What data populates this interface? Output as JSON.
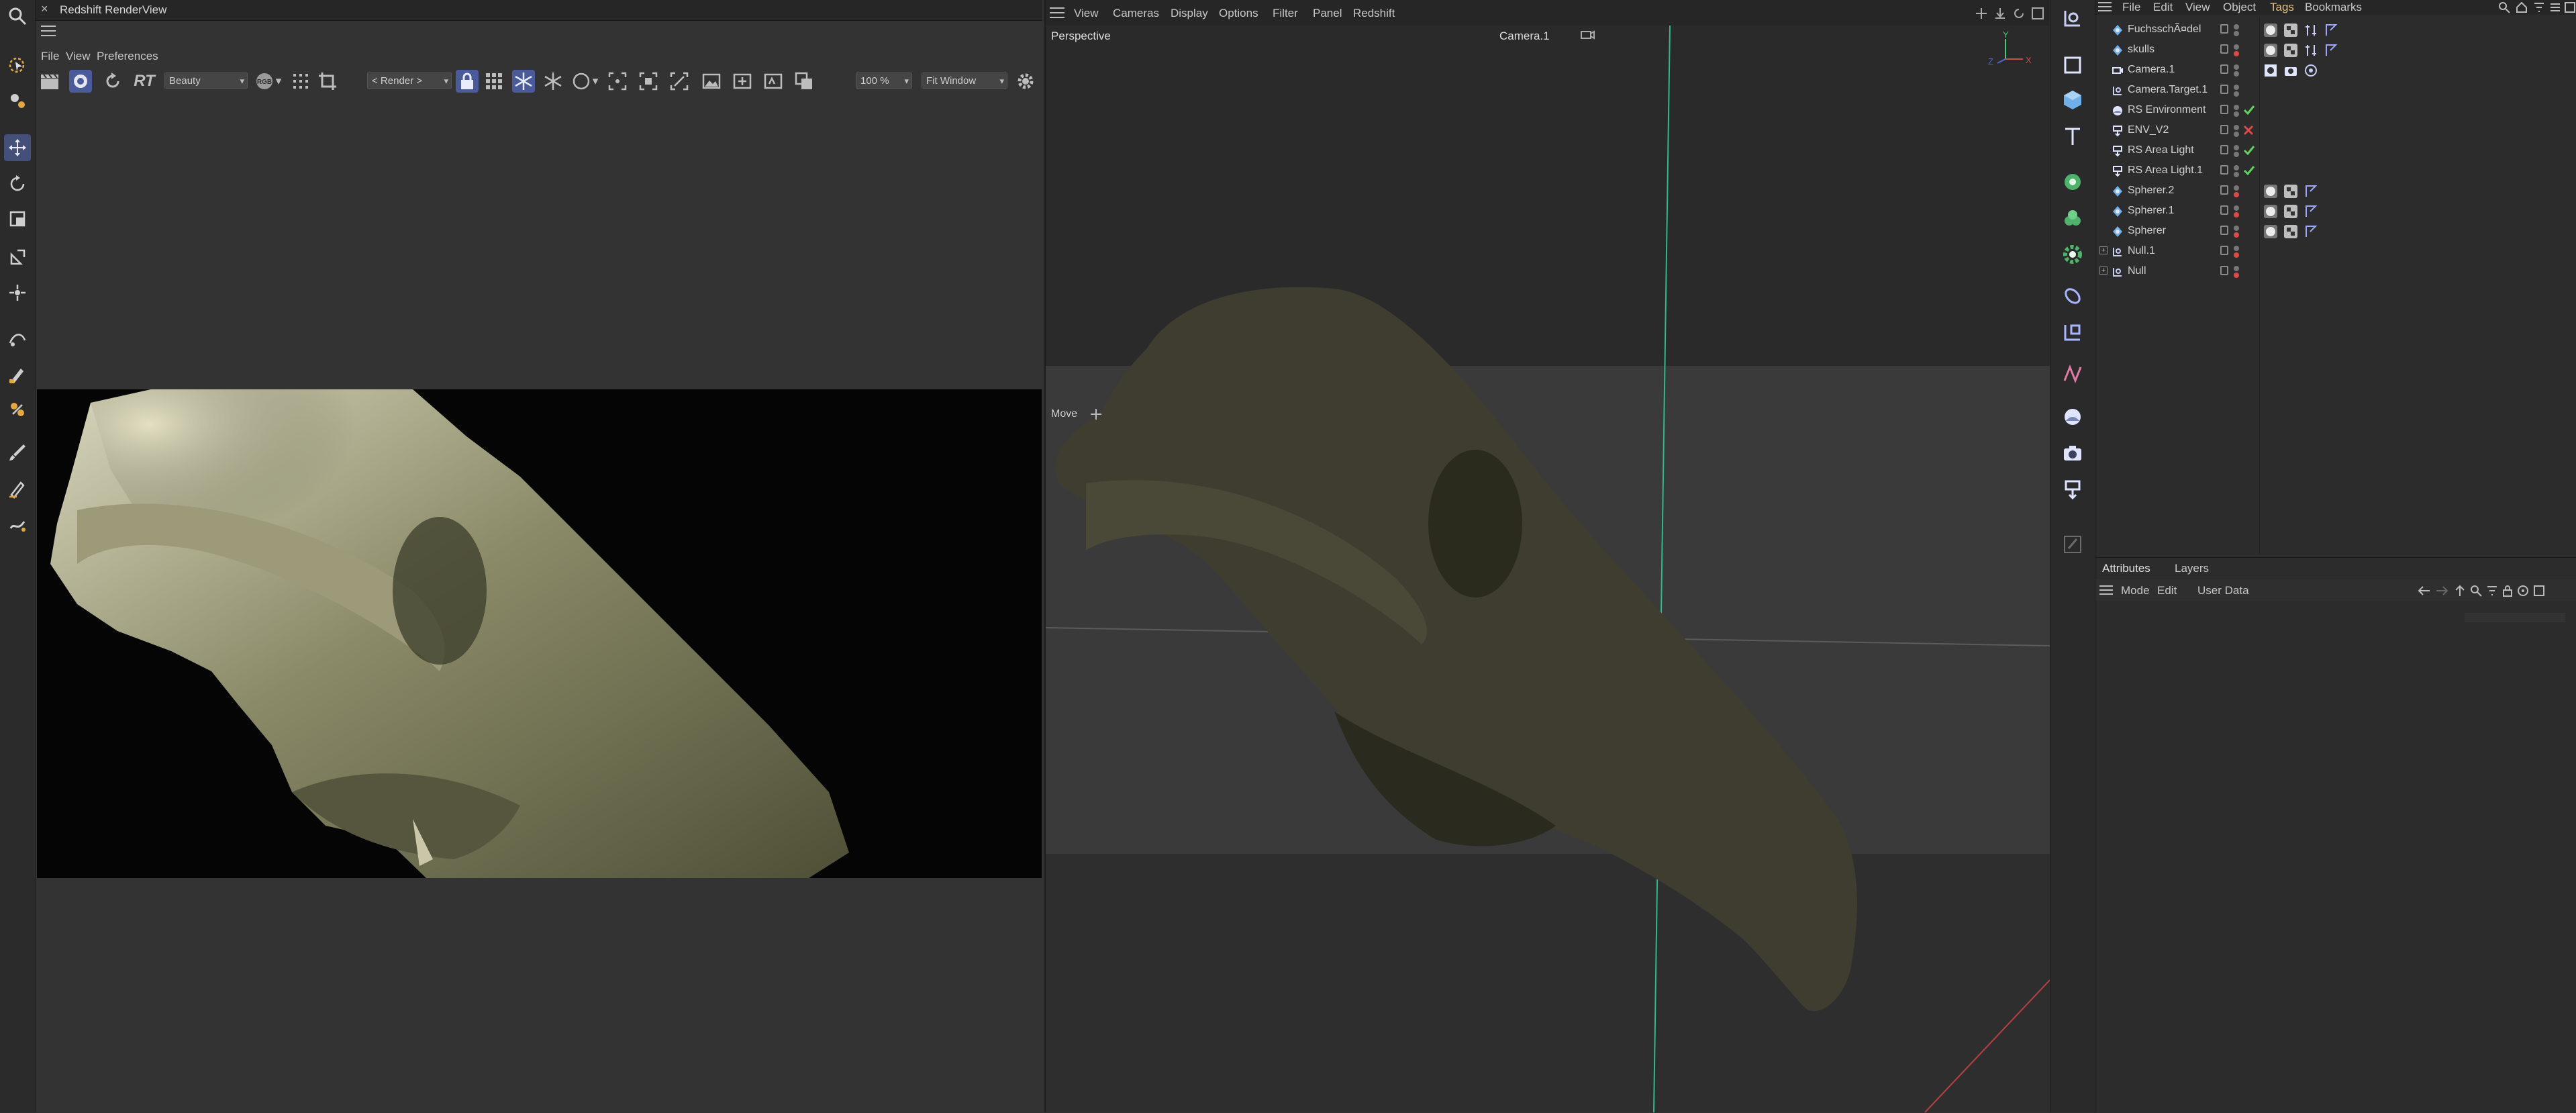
{
  "renderview": {
    "title": "Redshift RenderView",
    "close_glyph": "×",
    "menu": [
      "File",
      "View",
      "Preferences"
    ],
    "aov_select": "Beauty",
    "render_select": "< Render >",
    "zoom": "100 %",
    "fit_select": "Fit Window",
    "rt_label": "RT",
    "rgb_label": "RGB"
  },
  "viewport": {
    "menu": [
      "View",
      "Cameras",
      "Display",
      "Options",
      "Filter",
      "Panel",
      "Redshift"
    ],
    "projection": "Perspective",
    "camera": "Camera.1",
    "tool_label": "Move",
    "axis_labels": {
      "y": "Y",
      "x": "X",
      "z": "Z"
    }
  },
  "object_manager": {
    "menu": [
      "File",
      "Edit",
      "View",
      "Object",
      "Tags",
      "Bookmarks"
    ],
    "active_menu": "Tags",
    "objects": [
      {
        "name": "FuchsschÃ¤del",
        "icon": "sphere-generator-icon",
        "status": "dots",
        "tags": [
          "material",
          "phong",
          "sampler",
          "flag"
        ]
      },
      {
        "name": "skulls",
        "icon": "sphere-generator-icon",
        "status": "dots-red",
        "tags": [
          "material",
          "phong",
          "sampler",
          "flag"
        ]
      },
      {
        "name": "Camera.1",
        "icon": "camera-object-icon",
        "status": "dots",
        "tags": [
          "target",
          "camera",
          "protection"
        ]
      },
      {
        "name": "Camera.Target.1",
        "icon": "null-object-icon",
        "status": "dots",
        "tags": []
      },
      {
        "name": "RS Environment",
        "icon": "environment-icon",
        "status": "check",
        "tags": []
      },
      {
        "name": "ENV_V2",
        "icon": "light-icon",
        "status": "cross",
        "tags": []
      },
      {
        "name": "RS Area Light",
        "icon": "light-icon",
        "status": "check",
        "tags": []
      },
      {
        "name": "RS Area Light.1",
        "icon": "light-icon",
        "status": "check",
        "tags": []
      },
      {
        "name": "Spherer.2",
        "icon": "sphere-generator-icon",
        "status": "dots-red",
        "tags": [
          "material",
          "phong",
          "flag"
        ]
      },
      {
        "name": "Spherer.1",
        "icon": "sphere-generator-icon",
        "status": "dots-red",
        "tags": [
          "material",
          "phong",
          "flag"
        ]
      },
      {
        "name": "Spherer",
        "icon": "sphere-generator-icon",
        "status": "dots-red",
        "tags": [
          "material",
          "phong",
          "flag"
        ]
      },
      {
        "name": "Null.1",
        "icon": "null-object-icon",
        "status": "dots-red",
        "tags": []
      },
      {
        "name": "Null",
        "icon": "null-object-icon",
        "status": "dots-red",
        "tags": []
      }
    ]
  },
  "attributes": {
    "tabs": [
      "Attributes",
      "Layers"
    ],
    "menu": [
      "Mode",
      "Edit",
      "User Data"
    ]
  },
  "colors": {
    "accent": "#4b5a9a",
    "check": "#5fd35f",
    "cross": "#e04848",
    "tags_active": "#e5c07b"
  }
}
